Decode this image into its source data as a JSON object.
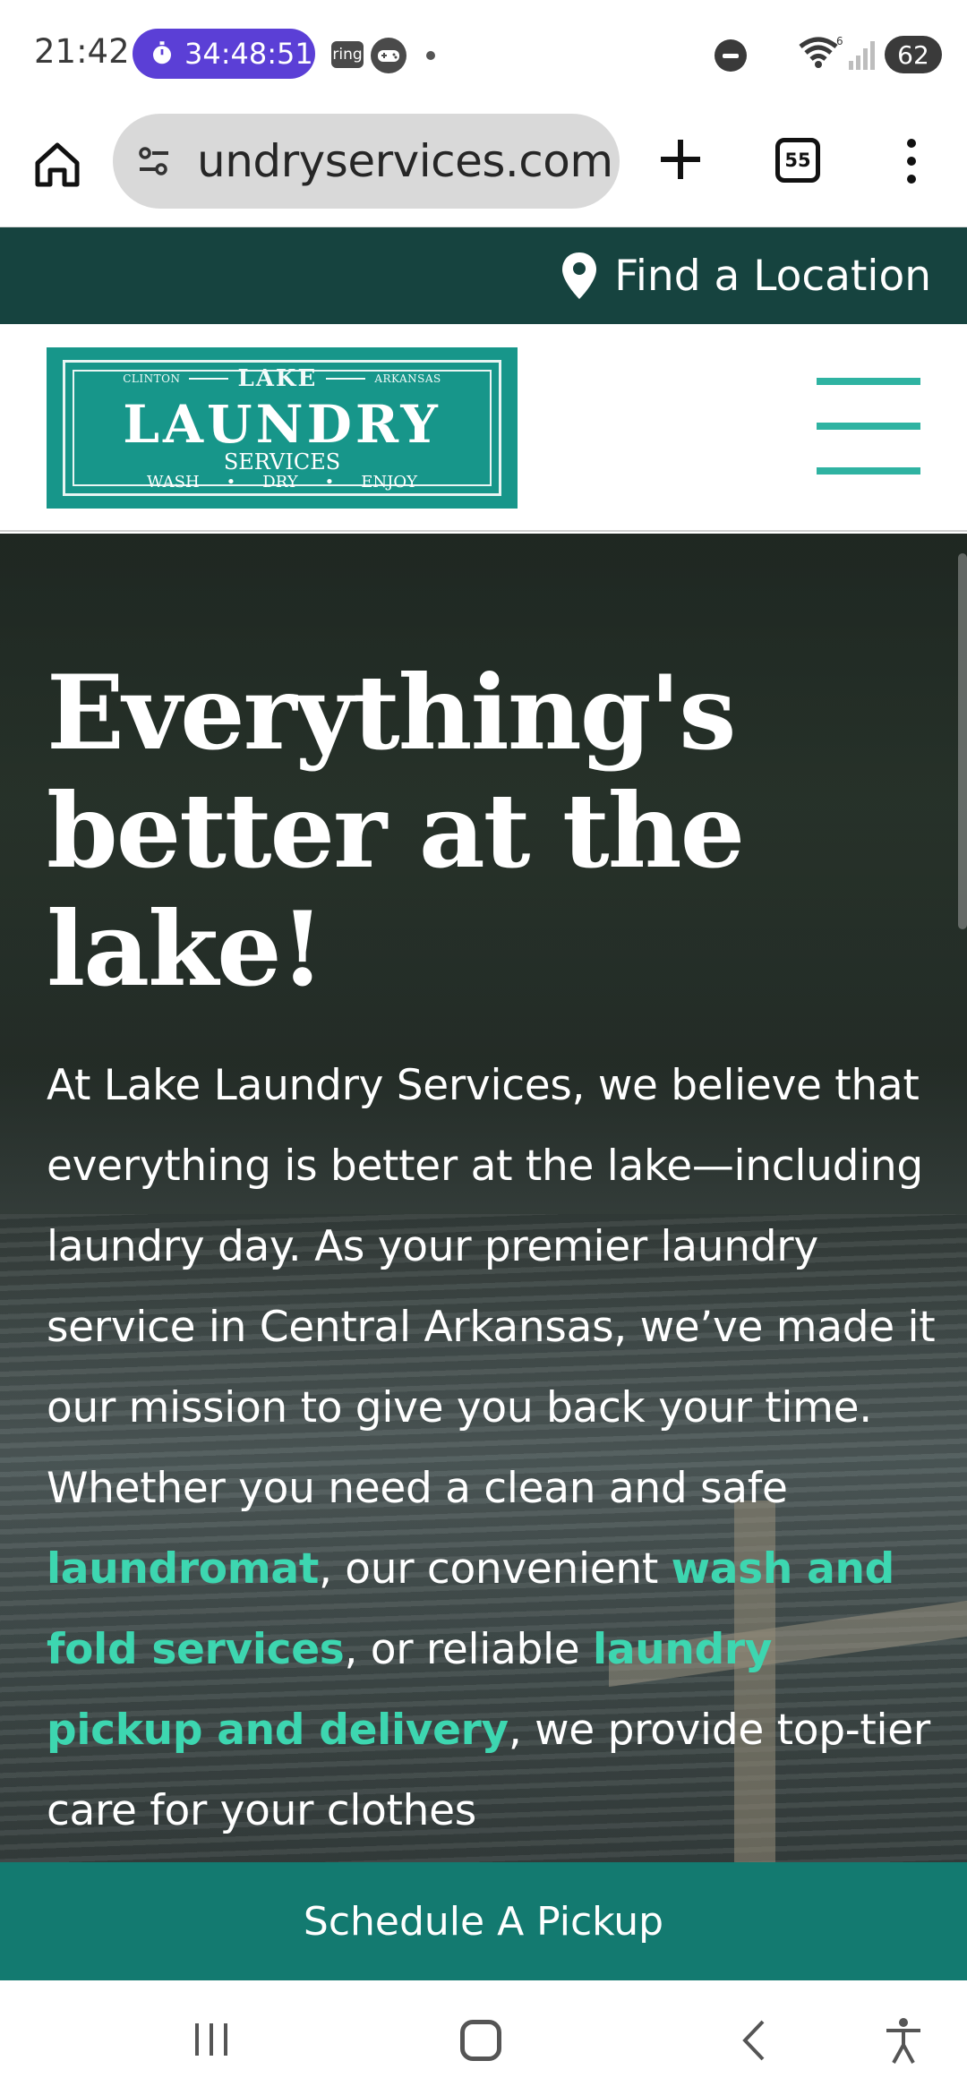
{
  "status_bar": {
    "time": "21:42",
    "timer": "34:48:51",
    "ring_app": "ring",
    "battery": "62",
    "wifi_badge": "6"
  },
  "browser": {
    "url": "undryservices.com",
    "tab_count": "55"
  },
  "location_bar": {
    "find_location": "Find a Location"
  },
  "logo": {
    "top_left": "CLINTON",
    "top_center": "LAKE",
    "top_right": "ARKANSAS",
    "main": "LAUNDRY",
    "sub": "SERVICES",
    "tagline": [
      "WASH",
      "DRY",
      "ENJOY"
    ]
  },
  "hero": {
    "title": "Everything's better at the lake!",
    "body_intro": "At Lake Laundry Services, we believe that everything is better at the lake—including laundry day. As your premier laundry service in Central Arkansas, we’ve made it our mission to give you back your time. Whether you need a clean and safe ",
    "link_laundromat": "laundromat",
    "body_mid1": ", our convenient ",
    "link_wash_fold": "wash and fold services",
    "body_mid2": ", or reliable ",
    "link_pickup": "laundry pickup and delivery",
    "body_end": ", we provide top-tier care for your clothes"
  },
  "cta": {
    "label": "Schedule A Pickup"
  },
  "colors": {
    "location_bar": "#16433f",
    "logo_bg": "#17968a",
    "accent_link": "#3dd6b0",
    "cta_bg": "#137a70",
    "timer_pill": "#5b3fd6"
  }
}
